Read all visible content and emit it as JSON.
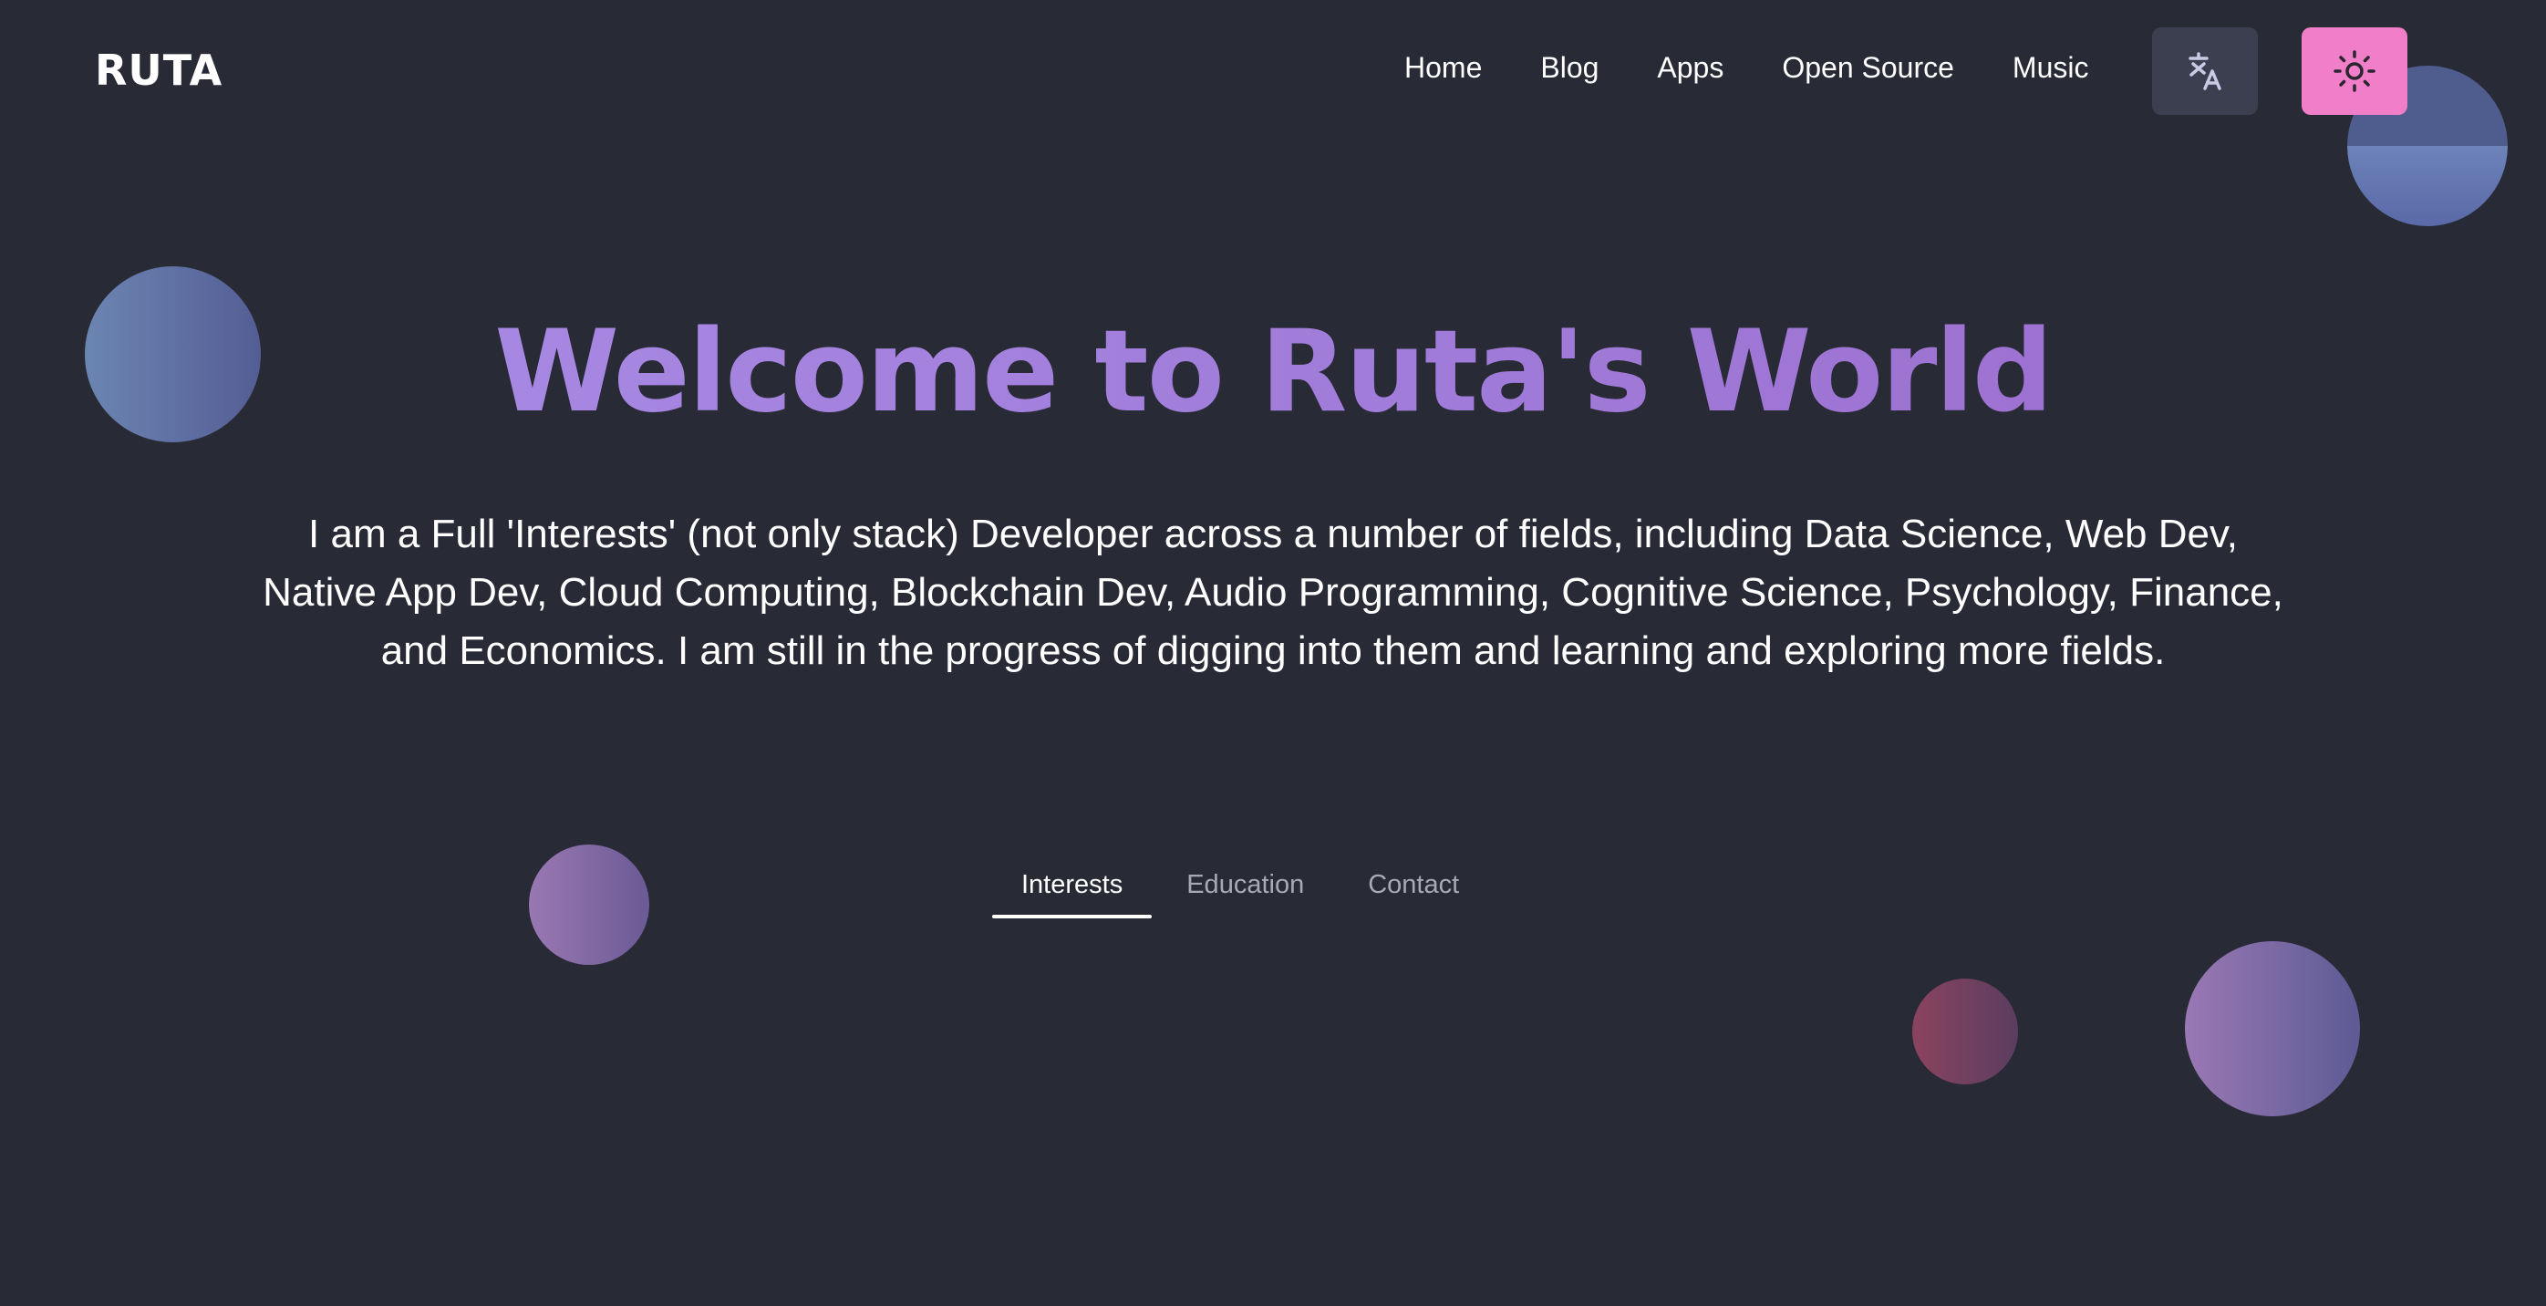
{
  "header": {
    "logo": "RUTA",
    "nav": [
      {
        "label": "Home"
      },
      {
        "label": "Blog"
      },
      {
        "label": "Apps"
      },
      {
        "label": "Open Source"
      },
      {
        "label": "Music"
      }
    ],
    "buttons": {
      "language_icon": "translate-icon",
      "theme_icon": "sun-icon"
    }
  },
  "hero": {
    "title": "Welcome to Ruta's World",
    "description": "I am a Full 'Interests' (not only stack) Developer across a number of fields, including Data Science, Web Dev, Native App Dev, Cloud Computing, Blockchain Dev, Audio Programming, Cognitive Science, Psychology, Finance, and Economics. I am still in the progress of digging into them and learning and exploring more fields."
  },
  "tabs": [
    {
      "label": "Interests",
      "active": true
    },
    {
      "label": "Education",
      "active": false
    },
    {
      "label": "Contact",
      "active": false
    }
  ],
  "colors": {
    "background": "#282a35",
    "accent_pink": "#f07ec9",
    "title_purple": "#a98ee6",
    "lang_button": "#3c3f4f"
  }
}
